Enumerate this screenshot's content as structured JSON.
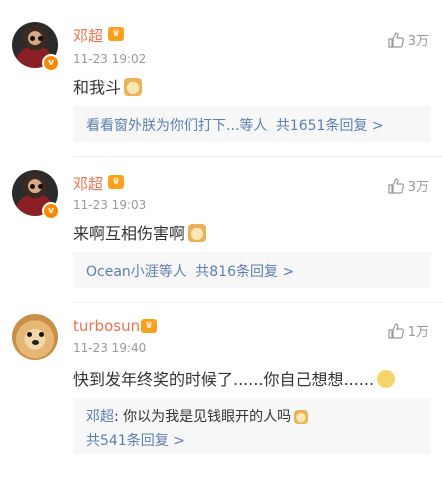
{
  "comments": [
    {
      "name": "邓超",
      "time": "11-23 19:02",
      "likes": "3万",
      "text": "和我斗",
      "emoji": "doge-icon",
      "reply_summary": "看看窗外朕为你们打下...等人",
      "reply_count": "共1651条回复 >"
    },
    {
      "name": "邓超",
      "time": "11-23 19:03",
      "likes": "3万",
      "text": "来啊互相伤害啊",
      "emoji": "doge-icon",
      "reply_summary": "Ocean小涯等人",
      "reply_count": "共816条回复 >"
    },
    {
      "name": "turbosun",
      "time": "11-23 19:40",
      "likes": "1万",
      "text": "快到发年终奖的时候了......你自己想想......",
      "emoji": "smile-icon",
      "reply_author": "邓超",
      "reply_text": ": 你以为我是见钱眼开的人吗",
      "reply_count": "共541条回复 >"
    }
  ],
  "colors": {
    "name": "#eb7350",
    "link": "#5b7fb3",
    "meta": "#999999",
    "reply_bg": "#f7f7f7"
  }
}
